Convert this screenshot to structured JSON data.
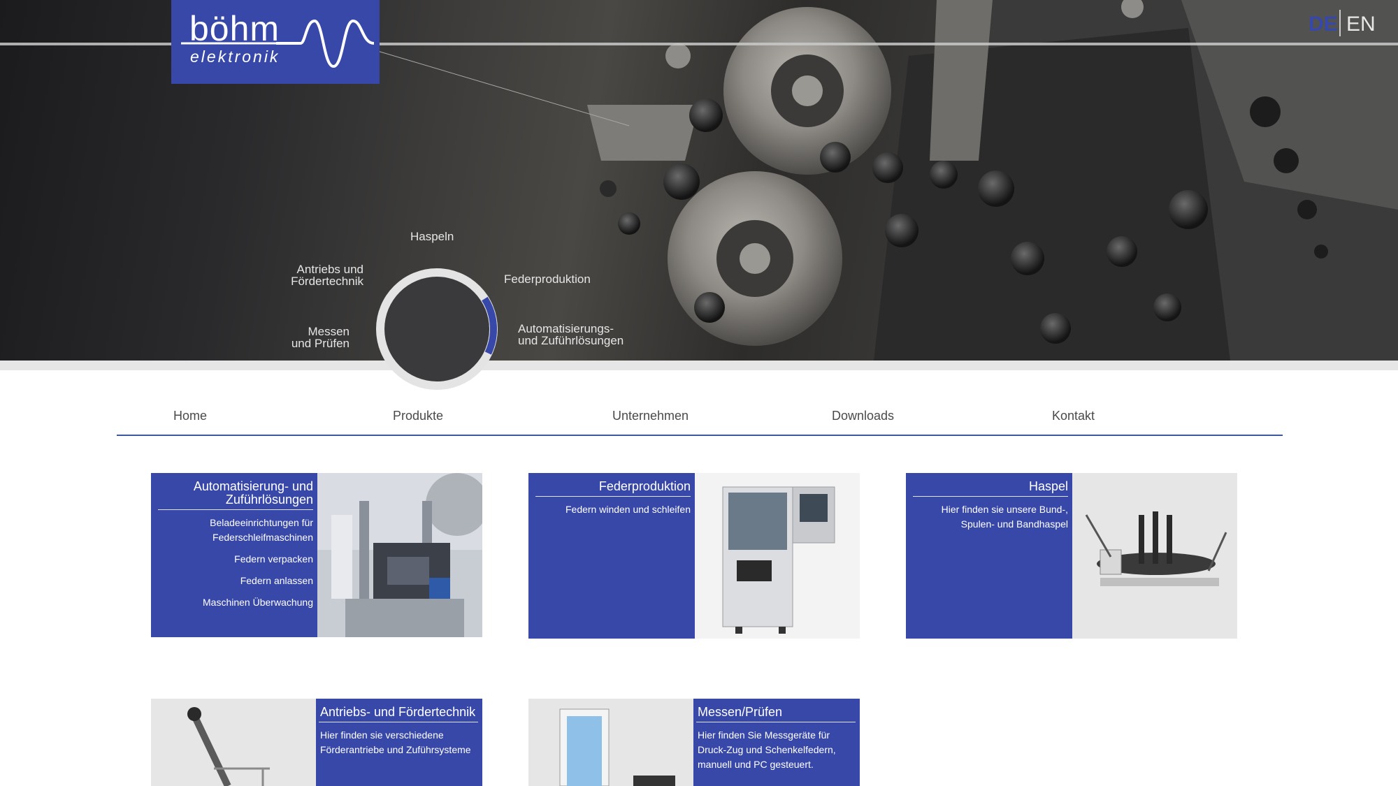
{
  "brand": {
    "name": "böhm",
    "subtitle": "elektronik"
  },
  "language": {
    "active": "DE",
    "other": "EN"
  },
  "dial": {
    "labels": [
      {
        "id": "haspeln",
        "text": "Haspeln"
      },
      {
        "id": "antriebs",
        "line1": "Antriebs und",
        "line2": "Fördertechnik"
      },
      {
        "id": "federproduktion",
        "text": "Federproduktion"
      },
      {
        "id": "messen",
        "line1": "Messen",
        "line2": "und Prüfen"
      },
      {
        "id": "automatisierung",
        "line1": "Automatisierungs-",
        "line2": "und Zuführlösungen"
      }
    ]
  },
  "nav": {
    "items": [
      "Home",
      "Produkte",
      "Unternehmen",
      "Downloads",
      "Kontakt"
    ]
  },
  "cards": [
    {
      "title": "Automatisierung- und Zuführlösungen",
      "items": [
        "Beladeeinrichtungen für Federschleifmaschinen",
        "Federn verpacken",
        "Federn anlassen",
        "Maschinen Überwachung"
      ]
    },
    {
      "title": "Federproduktion",
      "body": "Federn winden und schleifen"
    },
    {
      "title": "Haspel",
      "body": "Hier finden sie unsere Bund-, Spulen- und Bandhaspel"
    },
    {
      "title": "Antriebs- und Fördertechnik",
      "body": "Hier finden sie verschiedene Förderantriebe und Zuführsysteme"
    },
    {
      "title": "Messen/Prüfen",
      "body": "Hier finden Sie Messgeräte für Druck-Zug und Schenkelfedern, manuell und PC gesteuert."
    }
  ],
  "colors": {
    "brand_blue": "#3848a8",
    "nav_rule": "#3c57a0",
    "dial_progress": "#3848a8"
  },
  "dial_progress_fraction": 0.16
}
